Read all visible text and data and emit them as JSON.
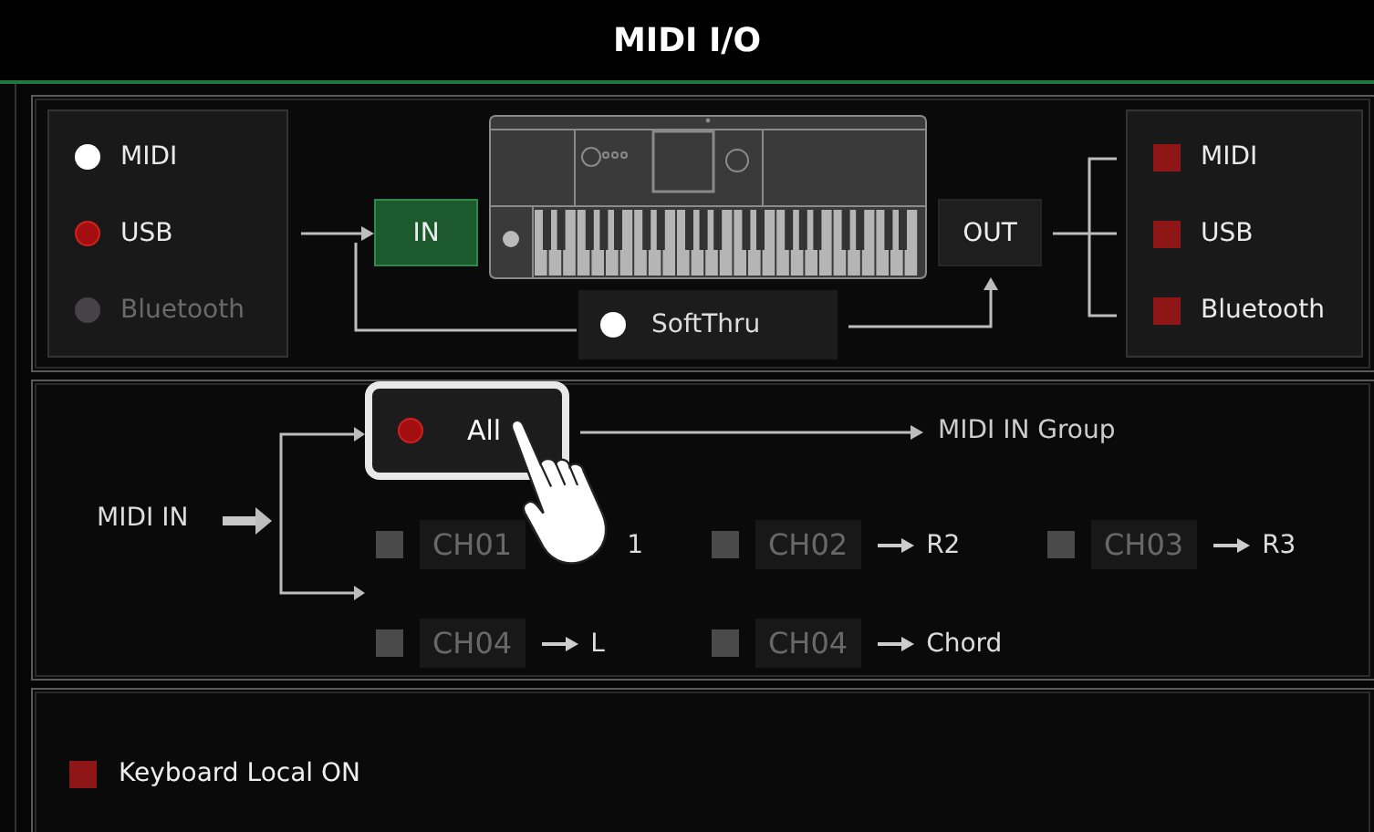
{
  "title": "MIDI I/O",
  "inputs": [
    {
      "label": "MIDI",
      "selected": false,
      "disabled": false
    },
    {
      "label": "USB",
      "selected": true,
      "disabled": false
    },
    {
      "label": "Bluetooth",
      "selected": false,
      "disabled": true
    }
  ],
  "in_button": "IN",
  "out_button": "OUT",
  "soft_thru": {
    "label": "SoftThru",
    "selected": false
  },
  "outputs": [
    {
      "label": "MIDI",
      "checked": true
    },
    {
      "label": "USB",
      "checked": true
    },
    {
      "label": "Bluetooth",
      "checked": true
    }
  ],
  "midi_in": {
    "label": "MIDI IN",
    "all": {
      "label": "All",
      "selected": true
    },
    "group_label": "MIDI IN Group",
    "channel_rows": [
      [
        {
          "channel": "CH01",
          "target": "1",
          "checked": false,
          "disabled": true,
          "covered": true
        },
        {
          "channel": "CH02",
          "target": "R2",
          "checked": false,
          "disabled": true,
          "covered": false
        },
        {
          "channel": "CH03",
          "target": "R3",
          "checked": false,
          "disabled": true,
          "covered": false
        }
      ],
      [
        {
          "channel": "CH04",
          "target": "L",
          "checked": false,
          "disabled": true,
          "covered": false
        },
        {
          "channel": "CH04",
          "target": "Chord",
          "checked": false,
          "disabled": true,
          "covered": false
        }
      ]
    ]
  },
  "keyboard_local": {
    "label": "Keyboard Local ON",
    "checked": true
  }
}
